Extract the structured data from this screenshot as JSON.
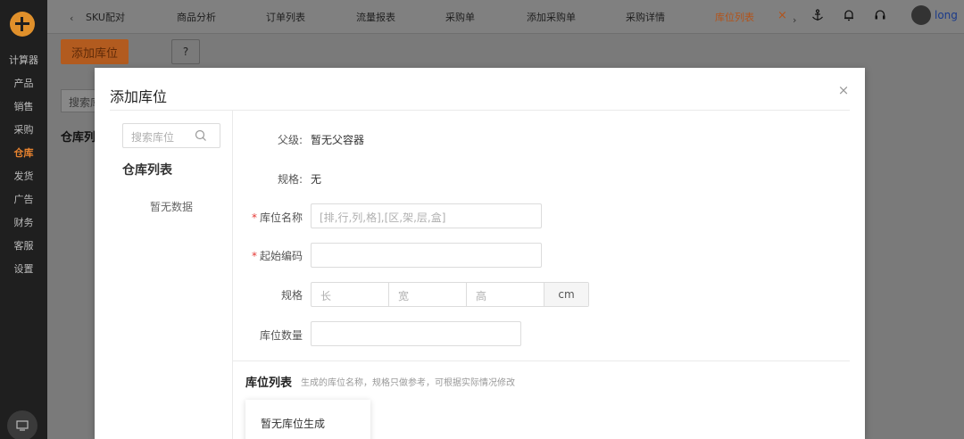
{
  "sidebar": {
    "items": [
      {
        "label": "计算器"
      },
      {
        "label": "产品"
      },
      {
        "label": "销售"
      },
      {
        "label": "采购"
      },
      {
        "label": "仓库"
      },
      {
        "label": "发货"
      },
      {
        "label": "广告"
      },
      {
        "label": "财务"
      },
      {
        "label": "客服"
      },
      {
        "label": "设置"
      }
    ],
    "active_index": 4
  },
  "topbar": {
    "prev_arrow": "‹",
    "next_arrow": "›",
    "tabs": [
      {
        "label": "SKU配对"
      },
      {
        "label": "商品分析"
      },
      {
        "label": "订单列表"
      },
      {
        "label": "流量报表"
      },
      {
        "label": "采购单"
      },
      {
        "label": "添加采购单"
      },
      {
        "label": "采购详情"
      },
      {
        "label": "库位列表"
      }
    ],
    "active_tab_close": "×",
    "username": "long"
  },
  "page": {
    "add_button": "添加库位",
    "help_icon": "?",
    "search_placeholder": "搜索库位",
    "section_title": "仓库列表"
  },
  "modal": {
    "title": "添加库位",
    "close": "×",
    "left": {
      "search_placeholder": "搜索库位",
      "title": "仓库列表",
      "empty": "暂无数据"
    },
    "form": {
      "parent_label": "父级:",
      "parent_value": "暂无父容器",
      "spec_label": "规格:",
      "spec_value": "无",
      "name_label": "库位名称",
      "name_placeholder": "[排,行,列,格],[区,架,层,盒]",
      "code_label": "起始编码",
      "spec_input_label": "规格",
      "length_placeholder": "长",
      "width_placeholder": "宽",
      "height_placeholder": "高",
      "unit": "cm",
      "count_label": "库位数量",
      "required_mark": "*"
    },
    "list": {
      "title": "库位列表",
      "hint": "生成的库位名称，规格只做参考，可根据实际情况修改",
      "empty": "暂无库位生成"
    }
  }
}
